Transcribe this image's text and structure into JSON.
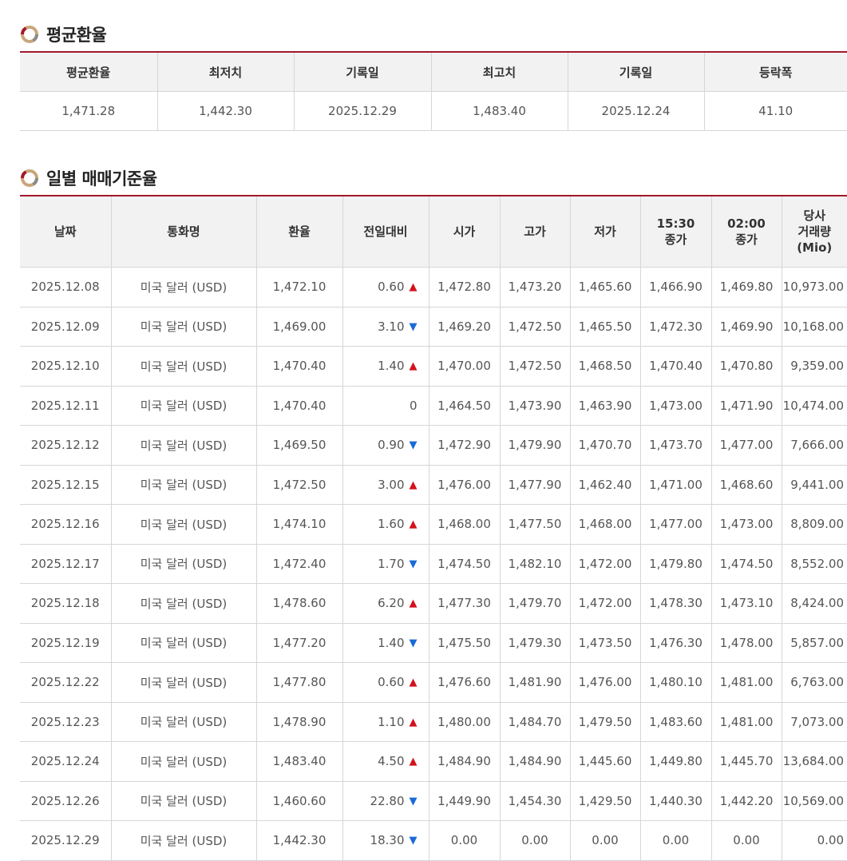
{
  "avg_section": {
    "title": "평균환율",
    "headers": [
      "평균환율",
      "최저치",
      "기록일",
      "최고치",
      "기록일",
      "등락폭"
    ],
    "values": [
      "1,471.28",
      "1,442.30",
      "2025.12.29",
      "1,483.40",
      "2025.12.24",
      "41.10"
    ]
  },
  "daily_section": {
    "title": "일별 매매기준율",
    "headers": [
      "날짜",
      "통화명",
      "환율",
      "전일대비",
      "시가",
      "고가",
      "저가",
      "15:30\n종가",
      "02:00\n종가",
      "당사\n거래량\n(Mio)"
    ],
    "rows": [
      {
        "date": "2025.12.08",
        "currency": "미국 달러 (USD)",
        "rate": "1,472.10",
        "change": "0.60",
        "dir": "up",
        "open": "1,472.80",
        "high": "1,473.20",
        "low": "1,465.60",
        "close1530": "1,466.90",
        "close0200": "1,469.80",
        "volume": "10,973.00"
      },
      {
        "date": "2025.12.09",
        "currency": "미국 달러 (USD)",
        "rate": "1,469.00",
        "change": "3.10",
        "dir": "down",
        "open": "1,469.20",
        "high": "1,472.50",
        "low": "1,465.50",
        "close1530": "1,472.30",
        "close0200": "1,469.90",
        "volume": "10,168.00"
      },
      {
        "date": "2025.12.10",
        "currency": "미국 달러 (USD)",
        "rate": "1,470.40",
        "change": "1.40",
        "dir": "up",
        "open": "1,470.00",
        "high": "1,472.50",
        "low": "1,468.50",
        "close1530": "1,470.40",
        "close0200": "1,470.80",
        "volume": "9,359.00"
      },
      {
        "date": "2025.12.11",
        "currency": "미국 달러 (USD)",
        "rate": "1,470.40",
        "change": "0",
        "dir": "none",
        "open": "1,464.50",
        "high": "1,473.90",
        "low": "1,463.90",
        "close1530": "1,473.00",
        "close0200": "1,471.90",
        "volume": "10,474.00"
      },
      {
        "date": "2025.12.12",
        "currency": "미국 달러 (USD)",
        "rate": "1,469.50",
        "change": "0.90",
        "dir": "down",
        "open": "1,472.90",
        "high": "1,479.90",
        "low": "1,470.70",
        "close1530": "1,473.70",
        "close0200": "1,477.00",
        "volume": "7,666.00"
      },
      {
        "date": "2025.12.15",
        "currency": "미국 달러 (USD)",
        "rate": "1,472.50",
        "change": "3.00",
        "dir": "up",
        "open": "1,476.00",
        "high": "1,477.90",
        "low": "1,462.40",
        "close1530": "1,471.00",
        "close0200": "1,468.60",
        "volume": "9,441.00"
      },
      {
        "date": "2025.12.16",
        "currency": "미국 달러 (USD)",
        "rate": "1,474.10",
        "change": "1.60",
        "dir": "up",
        "open": "1,468.00",
        "high": "1,477.50",
        "low": "1,468.00",
        "close1530": "1,477.00",
        "close0200": "1,473.00",
        "volume": "8,809.00"
      },
      {
        "date": "2025.12.17",
        "currency": "미국 달러 (USD)",
        "rate": "1,472.40",
        "change": "1.70",
        "dir": "down",
        "open": "1,474.50",
        "high": "1,482.10",
        "low": "1,472.00",
        "close1530": "1,479.80",
        "close0200": "1,474.50",
        "volume": "8,552.00"
      },
      {
        "date": "2025.12.18",
        "currency": "미국 달러 (USD)",
        "rate": "1,478.60",
        "change": "6.20",
        "dir": "up",
        "open": "1,477.30",
        "high": "1,479.70",
        "low": "1,472.00",
        "close1530": "1,478.30",
        "close0200": "1,473.10",
        "volume": "8,424.00"
      },
      {
        "date": "2025.12.19",
        "currency": "미국 달러 (USD)",
        "rate": "1,477.20",
        "change": "1.40",
        "dir": "down",
        "open": "1,475.50",
        "high": "1,479.30",
        "low": "1,473.50",
        "close1530": "1,476.30",
        "close0200": "1,478.00",
        "volume": "5,857.00"
      },
      {
        "date": "2025.12.22",
        "currency": "미국 달러 (USD)",
        "rate": "1,477.80",
        "change": "0.60",
        "dir": "up",
        "open": "1,476.60",
        "high": "1,481.90",
        "low": "1,476.00",
        "close1530": "1,480.10",
        "close0200": "1,481.00",
        "volume": "6,763.00"
      },
      {
        "date": "2025.12.23",
        "currency": "미국 달러 (USD)",
        "rate": "1,478.90",
        "change": "1.10",
        "dir": "up",
        "open": "1,480.00",
        "high": "1,484.70",
        "low": "1,479.50",
        "close1530": "1,483.60",
        "close0200": "1,481.00",
        "volume": "7,073.00"
      },
      {
        "date": "2025.12.24",
        "currency": "미국 달러 (USD)",
        "rate": "1,483.40",
        "change": "4.50",
        "dir": "up",
        "open": "1,484.90",
        "high": "1,484.90",
        "low": "1,445.60",
        "close1530": "1,449.80",
        "close0200": "1,445.70",
        "volume": "13,684.00"
      },
      {
        "date": "2025.12.26",
        "currency": "미국 달러 (USD)",
        "rate": "1,460.60",
        "change": "22.80",
        "dir": "down",
        "open": "1,449.90",
        "high": "1,454.30",
        "low": "1,429.50",
        "close1530": "1,440.30",
        "close0200": "1,442.20",
        "volume": "10,569.00"
      },
      {
        "date": "2025.12.29",
        "currency": "미국 달러 (USD)",
        "rate": "1,442.30",
        "change": "18.30",
        "dir": "down",
        "open": "0.00",
        "high": "0.00",
        "low": "0.00",
        "close1530": "0.00",
        "close0200": "0.00",
        "volume": "0.00"
      }
    ]
  },
  "icons": {
    "section_icon": "ring-icon",
    "up_arrow": "triangle-up-icon",
    "down_arrow": "triangle-down-icon"
  },
  "colors": {
    "accent": "#a3182b",
    "up": "#d4111b",
    "down": "#1a6ad6",
    "header_bg": "#f2f2f2"
  }
}
